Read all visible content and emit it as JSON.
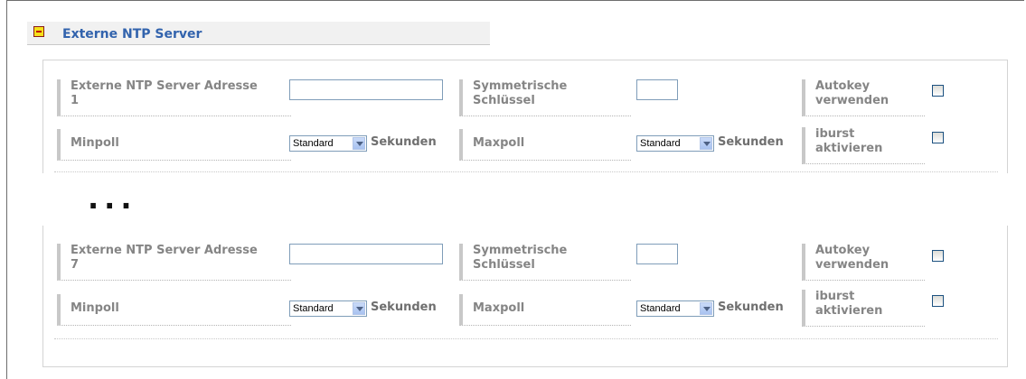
{
  "section": {
    "title": "Externe NTP Server",
    "expanded": true
  },
  "servers": [
    {
      "address_label_line1": "Externe NTP Server Adresse",
      "address_label_line2": "1",
      "address_value": "",
      "symkey_label_line1": "Symmetrische",
      "symkey_label_line2": "Schlüssel",
      "symkey_value": "",
      "autokey_label_line1": "Autokey",
      "autokey_label_line2": "verwenden",
      "autokey_checked": false,
      "minpoll_label": "Minpoll",
      "minpoll_value": "Standard",
      "minpoll_unit": "Sekunden",
      "maxpoll_label": "Maxpoll",
      "maxpoll_value": "Standard",
      "maxpoll_unit": "Sekunden",
      "iburst_label_line1": "iburst",
      "iburst_label_line2": "aktivieren",
      "iburst_checked": false
    },
    {
      "address_label_line1": "Externe NTP Server Adresse",
      "address_label_line2": "7",
      "address_value": "",
      "symkey_label_line1": "Symmetrische",
      "symkey_label_line2": "Schlüssel",
      "symkey_value": "",
      "autokey_label_line1": "Autokey",
      "autokey_label_line2": "verwenden",
      "autokey_checked": false,
      "minpoll_label": "Minpoll",
      "minpoll_value": "Standard",
      "minpoll_unit": "Sekunden",
      "maxpoll_label": "Maxpoll",
      "maxpoll_value": "Standard",
      "maxpoll_unit": "Sekunden",
      "iburst_label_line1": "iburst",
      "iburst_label_line2": "aktivieren",
      "iburst_checked": false
    }
  ],
  "gap_marker": "..."
}
